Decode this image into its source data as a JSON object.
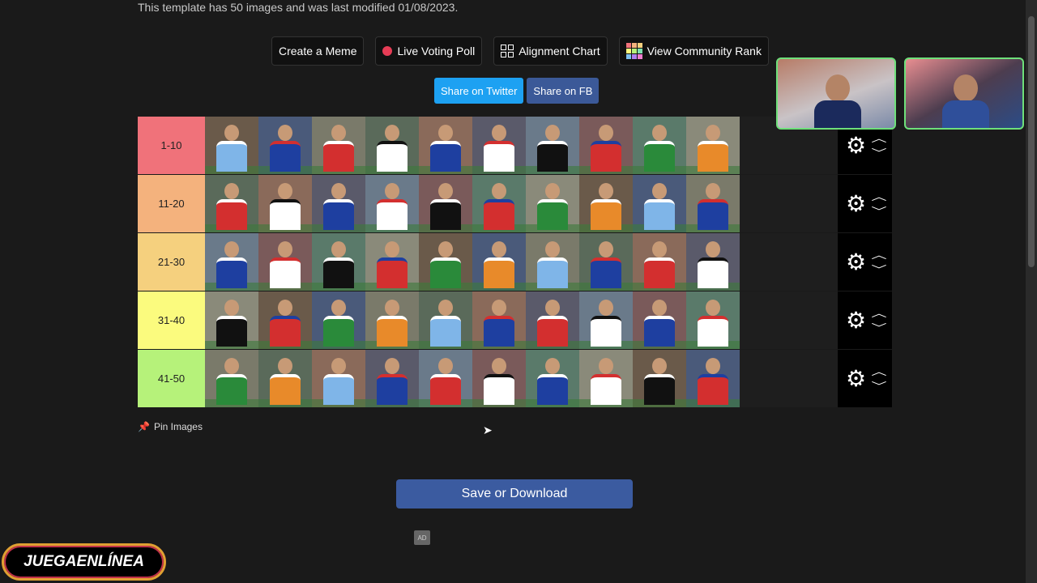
{
  "template_info": "This template has 50 images and was last modified 01/08/2023.",
  "buttons": {
    "create_meme": "Create a Meme",
    "live_voting": "Live Voting Poll",
    "alignment_chart": "Alignment Chart",
    "community_rank": "View Community Rank"
  },
  "share": {
    "twitter": "Share on Twitter",
    "facebook": "Share on FB"
  },
  "tiers": [
    {
      "label": "1-10",
      "color": "#f0727a",
      "count": 10
    },
    {
      "label": "11-20",
      "color": "#f4b27d",
      "count": 10
    },
    {
      "label": "21-30",
      "color": "#f5d07e",
      "count": 10
    },
    {
      "label": "31-40",
      "color": "#fbfb7e",
      "count": 10
    },
    {
      "label": "41-50",
      "color": "#b6f27a",
      "count": 10
    }
  ],
  "pin_images": "Pin Images",
  "save_download": "Save or Download",
  "ad_label": "AD",
  "brand": "JUEGAENLÍNEA",
  "colors": {
    "twitter": "#1da1f2",
    "facebook": "#3b5998",
    "save": "#3b5ba0",
    "webcam_border": "#6ee07a"
  }
}
